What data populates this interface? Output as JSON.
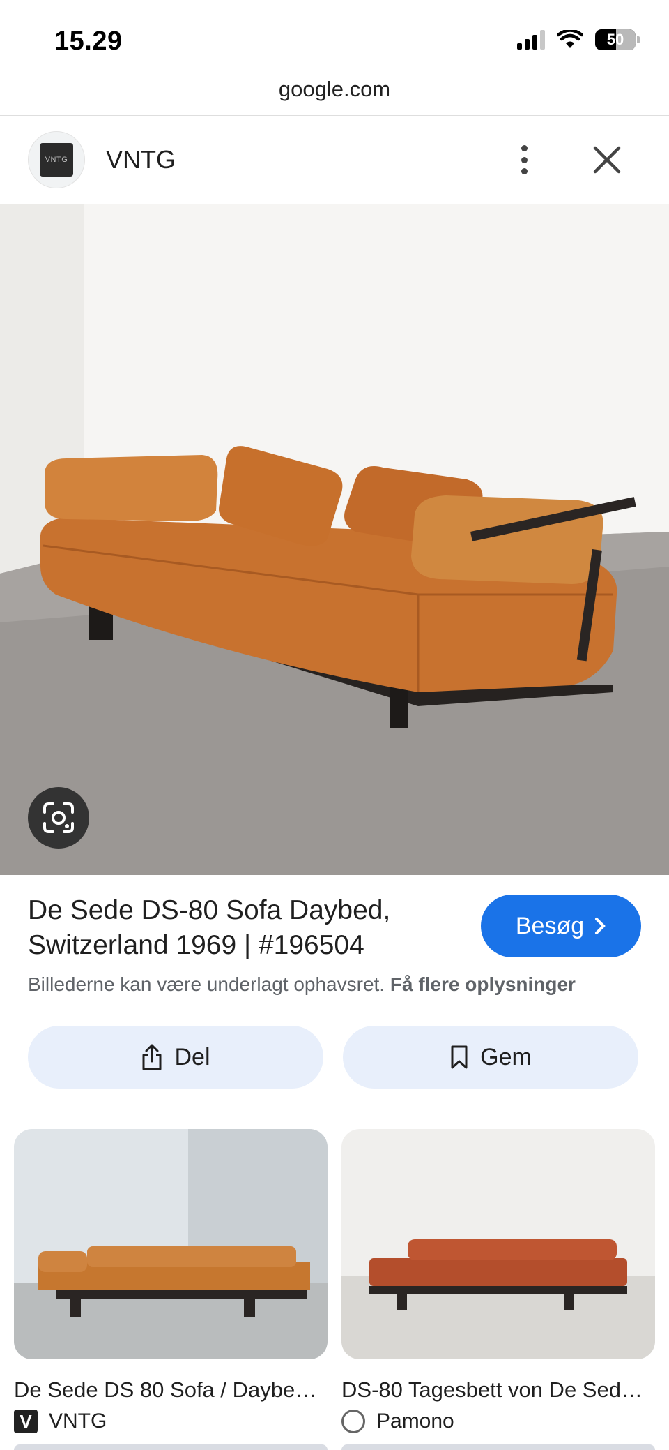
{
  "status_bar": {
    "time": "15.29",
    "battery": "50"
  },
  "browser": {
    "url": "google.com"
  },
  "header": {
    "site_logo_text": "VNTG",
    "site_name": "VNTG"
  },
  "result": {
    "title": "De Sede DS-80 Sofa Daybed, Switzerland 1969 | #196504",
    "visit_label": "Besøg",
    "copyright_text": "Billederne kan være underlagt ophavsret.",
    "more_info_label": "Få flere oplysninger",
    "share_label": "Del",
    "save_label": "Gem"
  },
  "related": [
    {
      "title": "De Sede DS 80 Sofa / Daybed…",
      "source": "VNTG",
      "source_icon": "V"
    },
    {
      "title": "DS-80 Tagesbett von De Sed…",
      "source": "Pamono"
    }
  ],
  "colors": {
    "accent": "#1a73e8",
    "button_bg": "#e8effb",
    "leather": "#c9732f"
  }
}
